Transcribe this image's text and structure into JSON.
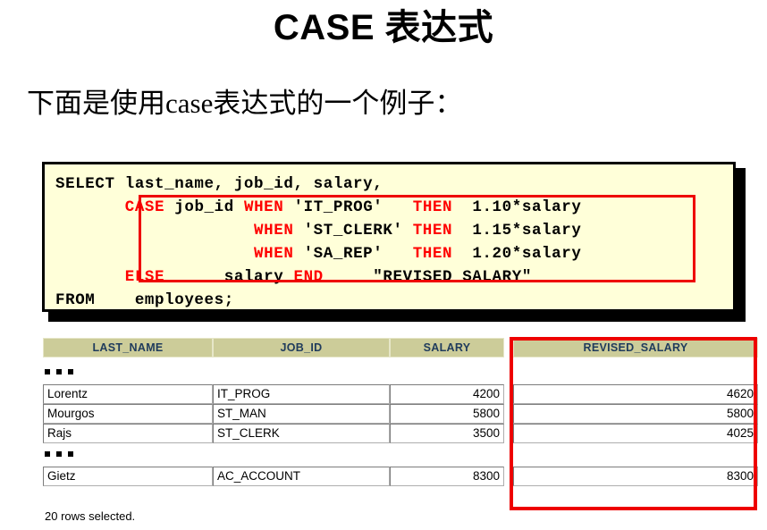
{
  "slide": {
    "title": "CASE 表达式",
    "subtitle": "下面是使用case表达式的一个例子："
  },
  "code_block": {
    "background_color": "#FFFFD9",
    "keyword_color": "#FF0000",
    "highlight_border_color": "#EE0000",
    "lines": [
      {
        "segments": [
          {
            "t": "SELECT last_name, job_id, salary,",
            "kw": false
          }
        ]
      },
      {
        "segments": [
          {
            "t": "       ",
            "kw": false
          },
          {
            "t": "CASE",
            "kw": true
          },
          {
            "t": " job_id ",
            "kw": false
          },
          {
            "t": "WHEN",
            "kw": true
          },
          {
            "t": " 'IT_PROG'   ",
            "kw": false
          },
          {
            "t": "THEN",
            "kw": true
          },
          {
            "t": "  1.10*salary",
            "kw": false
          }
        ]
      },
      {
        "segments": [
          {
            "t": "                    ",
            "kw": false
          },
          {
            "t": "WHEN",
            "kw": true
          },
          {
            "t": " 'ST_CLERK' ",
            "kw": false
          },
          {
            "t": "THEN",
            "kw": true
          },
          {
            "t": "  1.15*salary",
            "kw": false
          }
        ]
      },
      {
        "segments": [
          {
            "t": "                    ",
            "kw": false
          },
          {
            "t": "WHEN",
            "kw": true
          },
          {
            "t": " 'SA_REP'   ",
            "kw": false
          },
          {
            "t": "THEN",
            "kw": true
          },
          {
            "t": "  1.20*salary",
            "kw": false
          }
        ]
      },
      {
        "segments": [
          {
            "t": "       ",
            "kw": false
          },
          {
            "t": "ELSE",
            "kw": true
          },
          {
            "t": "      salary ",
            "kw": false
          },
          {
            "t": "END",
            "kw": true
          },
          {
            "t": "     \"REVISED_SALARY\"",
            "kw": false
          }
        ]
      },
      {
        "segments": [
          {
            "t": "FROM    employees;",
            "kw": false
          }
        ]
      }
    ]
  },
  "result_grid": {
    "header_bg_color": "#CCCC99",
    "header_text_color": "#1F3B5C",
    "highlight_border_color": "#EE0000",
    "highlighted_column": "REVISED_SALARY",
    "columns": [
      "LAST_NAME",
      "JOB_ID",
      "SALARY",
      "REVISED_SALARY"
    ],
    "rows": [
      {
        "type": "ellipsis"
      },
      {
        "type": "data",
        "cells": [
          "Lorentz",
          "IT_PROG",
          "4200",
          "4620"
        ]
      },
      {
        "type": "data",
        "cells": [
          "Mourgos",
          "ST_MAN",
          "5800",
          "5800"
        ]
      },
      {
        "type": "data",
        "cells": [
          "Rajs",
          "ST_CLERK",
          "3500",
          "4025"
        ]
      },
      {
        "type": "ellipsis"
      },
      {
        "type": "data",
        "cells": [
          "Gietz",
          "AC_ACCOUNT",
          "8300",
          "8300"
        ]
      }
    ],
    "footer": "20 rows selected."
  }
}
